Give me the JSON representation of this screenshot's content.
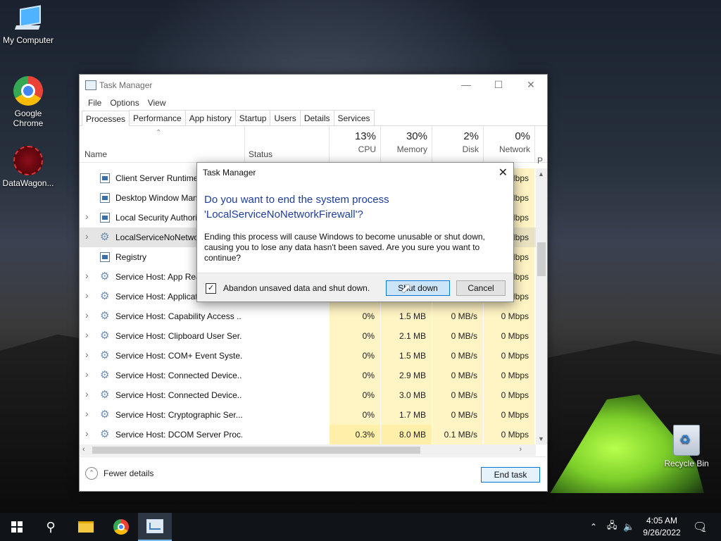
{
  "desktop": {
    "icons": [
      {
        "label": "My Computer"
      },
      {
        "label": "Google Chrome"
      },
      {
        "label": "DataWagon..."
      },
      {
        "label": "Recycle Bin"
      }
    ]
  },
  "task_manager": {
    "title": "Task Manager",
    "menu": [
      "File",
      "Options",
      "View"
    ],
    "tabs": [
      "Processes",
      "Performance",
      "App history",
      "Startup",
      "Users",
      "Details",
      "Services"
    ],
    "active_tab": "Processes",
    "columns": {
      "name": "Name",
      "status": "Status",
      "cpu": {
        "pct": "13%",
        "label": "CPU"
      },
      "memory": {
        "pct": "30%",
        "label": "Memory"
      },
      "disk": {
        "pct": "2%",
        "label": "Disk"
      },
      "network": {
        "pct": "0%",
        "label": "Network"
      },
      "power_cut": "P"
    },
    "rows": [
      {
        "name": "Client Server Runtime ...",
        "cpu": "",
        "mem": "",
        "disk": "",
        "net": "Mbps",
        "expand": false,
        "icon": "window"
      },
      {
        "name": "Desktop Window Mana...",
        "cpu": "",
        "mem": "",
        "disk": "",
        "net": "Mbps",
        "expand": false,
        "icon": "window"
      },
      {
        "name": "Local Security Authority...",
        "cpu": "",
        "mem": "",
        "disk": "",
        "net": "Mbps",
        "expand": true,
        "icon": "window"
      },
      {
        "name": "LocalServiceNoNetwork...",
        "cpu": "",
        "mem": "",
        "disk": "",
        "net": "Mbps",
        "expand": true,
        "icon": "gear",
        "selected": true
      },
      {
        "name": "Registry",
        "cpu": "",
        "mem": "",
        "disk": "",
        "net": "Mbps",
        "expand": false,
        "icon": "window"
      },
      {
        "name": "Service Host: App Read...",
        "cpu": "",
        "mem": "",
        "disk": "",
        "net": "Mbps",
        "expand": true,
        "icon": "gear"
      },
      {
        "name": "Service Host: Applicati...",
        "cpu": "",
        "mem": "",
        "disk": "",
        "net": "Mbps",
        "expand": true,
        "icon": "gear"
      },
      {
        "name": "Service Host: Capability Access ...",
        "cpu": "0%",
        "mem": "1.5 MB",
        "disk": "0 MB/s",
        "net": "0 Mbps",
        "expand": true,
        "icon": "gear"
      },
      {
        "name": "Service Host: Clipboard User Ser...",
        "cpu": "0%",
        "mem": "2.1 MB",
        "disk": "0 MB/s",
        "net": "0 Mbps",
        "expand": true,
        "icon": "gear"
      },
      {
        "name": "Service Host: COM+ Event Syste...",
        "cpu": "0%",
        "mem": "1.5 MB",
        "disk": "0 MB/s",
        "net": "0 Mbps",
        "expand": true,
        "icon": "gear"
      },
      {
        "name": "Service Host: Connected Device...",
        "cpu": "0%",
        "mem": "2.9 MB",
        "disk": "0 MB/s",
        "net": "0 Mbps",
        "expand": true,
        "icon": "gear"
      },
      {
        "name": "Service Host: Connected Device...",
        "cpu": "0%",
        "mem": "3.0 MB",
        "disk": "0 MB/s",
        "net": "0 Mbps",
        "expand": true,
        "icon": "gear"
      },
      {
        "name": "Service Host: Cryptographic Ser...",
        "cpu": "0%",
        "mem": "1.7 MB",
        "disk": "0 MB/s",
        "net": "0 Mbps",
        "expand": true,
        "icon": "gear"
      },
      {
        "name": "Service Host: DCOM Server Proc...",
        "cpu": "0.3%",
        "mem": "8.0 MB",
        "disk": "0.1 MB/s",
        "net": "0 Mbps",
        "expand": true,
        "icon": "gear"
      }
    ],
    "footer": {
      "fewer_details": "Fewer details",
      "end_task": "End task"
    }
  },
  "dialog": {
    "title": "Task Manager",
    "question": "Do you want to end the system process 'LocalServiceNoNetworkFirewall'?",
    "body": "Ending this process will cause Windows to become unusable or shut down, causing you to lose any data hasn't been saved. Are you sure you want to continue?",
    "checkbox_label": "Abandon unsaved data and shut down.",
    "checkbox_checked": true,
    "shutdown_label": "Shut down",
    "cancel_label": "Cancel"
  },
  "taskbar": {
    "time": "4:05 AM",
    "date": "9/26/2022",
    "notification_count": "1"
  }
}
